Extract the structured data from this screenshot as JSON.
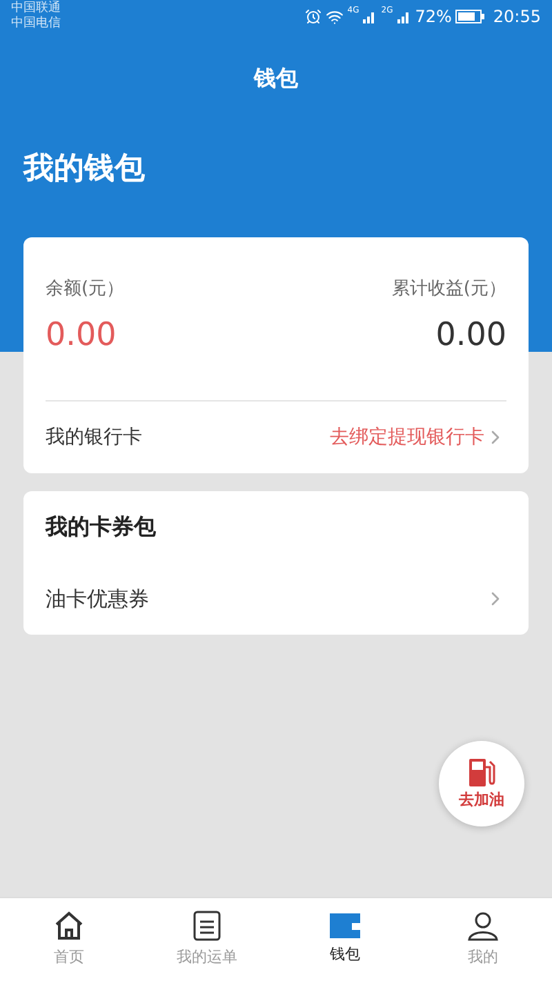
{
  "status_bar": {
    "carrier_1": "中国联通",
    "carrier_2": "中国电信",
    "network_1": "4G",
    "network_2": "2G",
    "battery": "72%",
    "time": "20:55"
  },
  "header": {
    "title": "钱包"
  },
  "page_title": "我的钱包",
  "balance_card": {
    "balance_label": "余额(元）",
    "balance": "0.00",
    "earnings_label": "累计收益(元）",
    "earnings": "0.00",
    "bank_label": "我的银行卡",
    "bank_action": "去绑定提现银行卡"
  },
  "coupon_card": {
    "title": "我的卡券包",
    "items": [
      {
        "label": "油卡优惠券"
      }
    ]
  },
  "fab": {
    "label": "去加油"
  },
  "tabs": [
    {
      "label": "首页",
      "kind": "home",
      "selected": false
    },
    {
      "label": "我的运单",
      "kind": "list",
      "selected": false
    },
    {
      "label": "钱包",
      "kind": "wallet",
      "selected": true
    },
    {
      "label": "我的",
      "kind": "user",
      "selected": false
    }
  ]
}
